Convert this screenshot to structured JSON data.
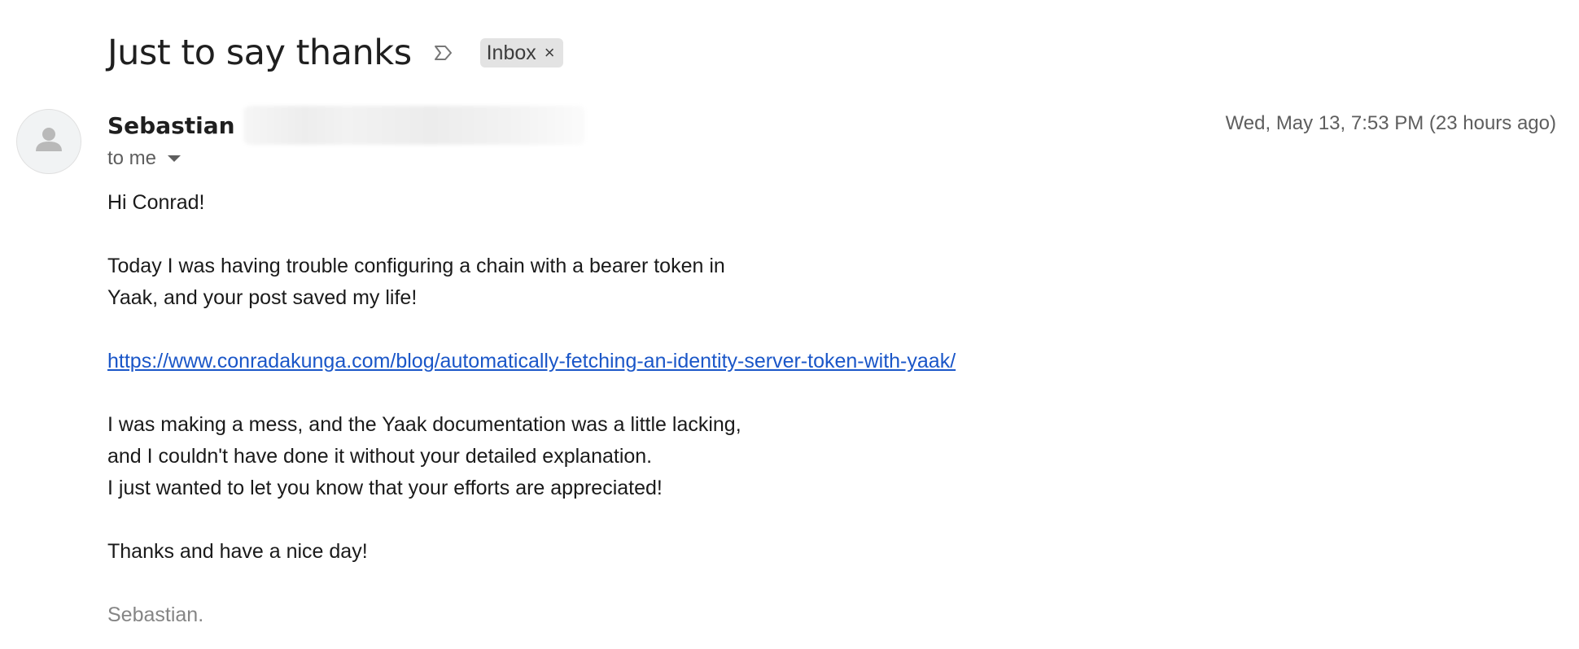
{
  "email": {
    "subject": "Just to say thanks",
    "label": "Inbox",
    "label_remove_glyph": "×",
    "sender_name": "Sebastian",
    "timestamp": "Wed, May 13, 7:53 PM (23 hours ago)",
    "recipient": "to me",
    "body": {
      "greeting": "Hi Conrad!",
      "para1_line1": "Today I was having trouble configuring a chain with a bearer token in",
      "para1_line2": "Yaak, and your post saved my life!",
      "link": "https://www.conradakunga.com/blog/automatically-fetching-an-identity-server-token-with-yaak/",
      "para2_line1": "I was making a mess, and the Yaak documentation was a little lacking,",
      "para2_line2": "and I couldn't have done it without your detailed explanation.",
      "para2_line3": "I just wanted to let you know that your efforts are appreciated!",
      "closing": "Thanks and have a nice day!",
      "signature": "Sebastian."
    }
  },
  "icons": {
    "importance": "importance-marker-icon",
    "avatar": "default-person-icon",
    "recipients_toggle": "chevron-down-icon"
  },
  "colors": {
    "link": "#1a56c8",
    "chip_background": "#e3e3e3",
    "muted_text": "#5e5e5e",
    "signature": "#858585"
  }
}
